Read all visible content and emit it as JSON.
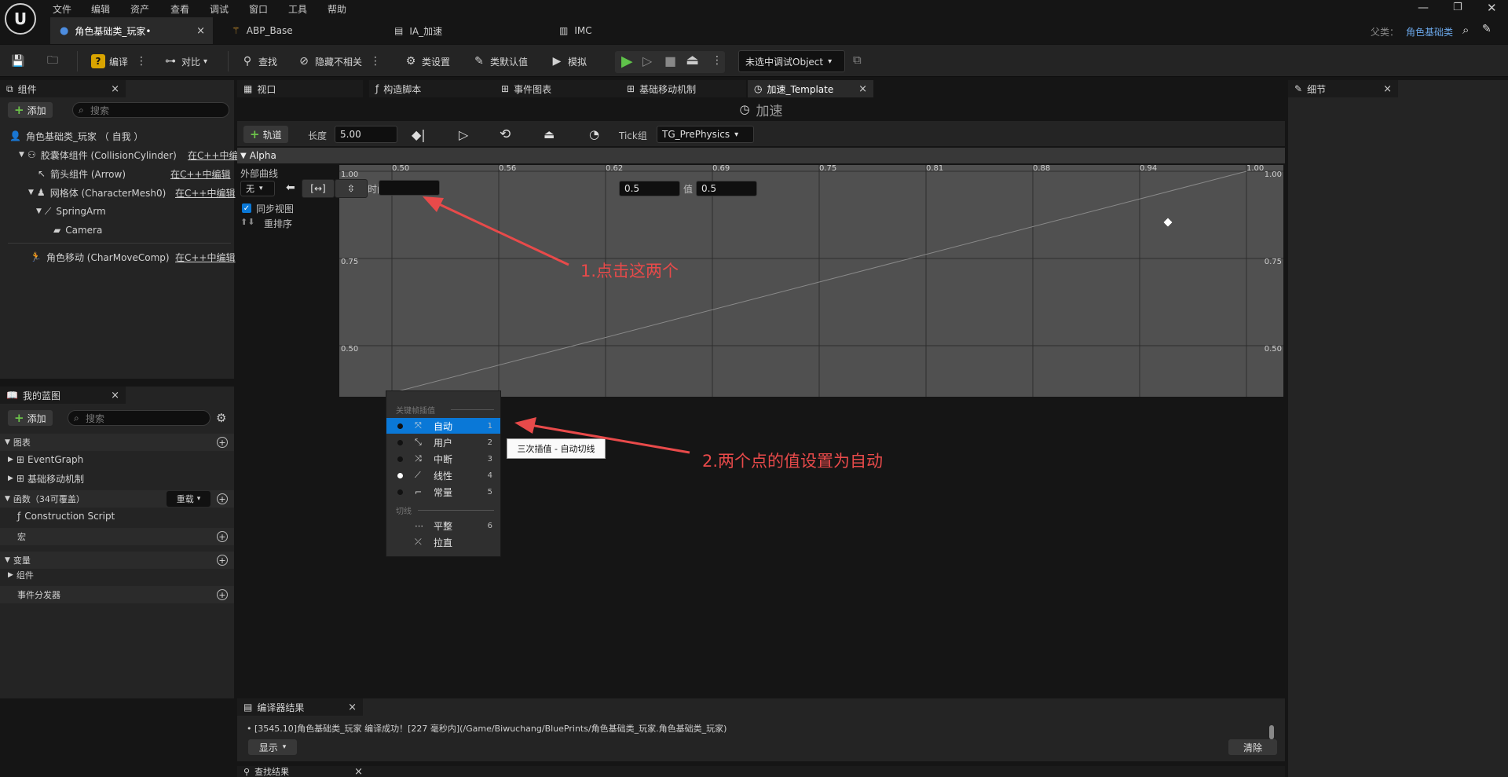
{
  "menu": [
    "文件",
    "编辑",
    "资产",
    "查看",
    "调试",
    "窗口",
    "工具",
    "帮助"
  ],
  "doc_tabs": [
    {
      "label": "角色基础类_玩家•",
      "close": "×"
    },
    {
      "label": "ABP_Base"
    },
    {
      "label": "IA_加速"
    },
    {
      "label": "IMC"
    }
  ],
  "parent_class": {
    "label": "父类：",
    "value": "角色基础类"
  },
  "toolbar": {
    "compile": "编译",
    "diff": "对比",
    "find": "查找",
    "hide_unrelated": "隐藏不相关",
    "class_settings": "类设置",
    "class_defaults": "类默认值",
    "simulate": "模拟",
    "debug_object": "未选中调试Object"
  },
  "components_panel": {
    "tab": "组件",
    "add": "添加",
    "search_placeholder": "搜索",
    "items": [
      {
        "label": "角色基础类_玩家 （ 自我 ）",
        "edit": ""
      },
      {
        "label": "胶囊体组件 (CollisionCylinder)",
        "edit": "在C++中编"
      },
      {
        "label": "箭头组件 (Arrow)",
        "edit": "在C++中编辑"
      },
      {
        "label": "网格体 (CharacterMesh0)",
        "edit": "在C++中编辑"
      },
      {
        "label": "SpringArm",
        "edit": ""
      },
      {
        "label": "Camera",
        "edit": ""
      },
      {
        "label": "角色移动 (CharMoveComp)",
        "edit": "在C++中编辑"
      }
    ]
  },
  "blueprint_panel": {
    "tab": "我的蓝图",
    "add": "添加",
    "search_placeholder": "搜索",
    "sections": {
      "graphs": "图表",
      "event_graph": "EventGraph",
      "movement": "基础移动机制",
      "functions": "函数（34可覆盖）",
      "override": "重载",
      "construction": "Construction Script",
      "macros": "宏",
      "variables": "变量",
      "components": "组件",
      "dispatchers": "事件分发器"
    }
  },
  "center_tabs": [
    {
      "label": "视口"
    },
    {
      "label": "构造脚本"
    },
    {
      "label": "事件图表"
    },
    {
      "label": "基础移动机制"
    },
    {
      "label": "加速_Template",
      "close": "×"
    }
  ],
  "timeline": {
    "title": "加速",
    "track_button": "轨道",
    "length_label": "长度",
    "length_value": "5.00",
    "tick_group_label": "Tick组",
    "tick_group_value": "TG_PrePhysics",
    "track_name": "Alpha",
    "external_curve": "外部曲线",
    "curve_select": "无",
    "sync_view": "同步视图",
    "reorder": "重排序",
    "time_label": "时间",
    "time_value": "0.5",
    "value_label": "值",
    "value_value": "0.5",
    "x_ticks": [
      "0.50",
      "0.56",
      "0.62",
      "0.69",
      "0.75",
      "0.81",
      "0.88",
      "0.94",
      "1.00"
    ],
    "y_ticks": [
      "1.00",
      "0.75",
      "0.50"
    ]
  },
  "context_menu": {
    "header_interp": "关键帧插值",
    "items": [
      {
        "label": "自动",
        "key": "1"
      },
      {
        "label": "用户",
        "key": "2"
      },
      {
        "label": "中断",
        "key": "3"
      },
      {
        "label": "线性",
        "key": "4"
      },
      {
        "label": "常量",
        "key": "5"
      }
    ],
    "header_tangent": "切线",
    "tangent_items": [
      {
        "label": "平整",
        "key": "6"
      },
      {
        "label": "拉直",
        "key": ""
      }
    ]
  },
  "tooltip": "三次插值 - 自动切线",
  "annotations": {
    "a1": "1.点击这两个",
    "a2": "2.两个点的值设置为自动"
  },
  "details_panel": {
    "tab": "细节"
  },
  "compiler": {
    "tab": "编译器结果",
    "log": "[3545.10]角色基础类_玩家 编译成功！[227 毫秒内](/Game/Biwuchang/BluePrints/角色基础类_玩家.角色基础类_玩家)",
    "show": "显示",
    "clear": "清除"
  },
  "find_results": {
    "tab": "查找结果"
  }
}
